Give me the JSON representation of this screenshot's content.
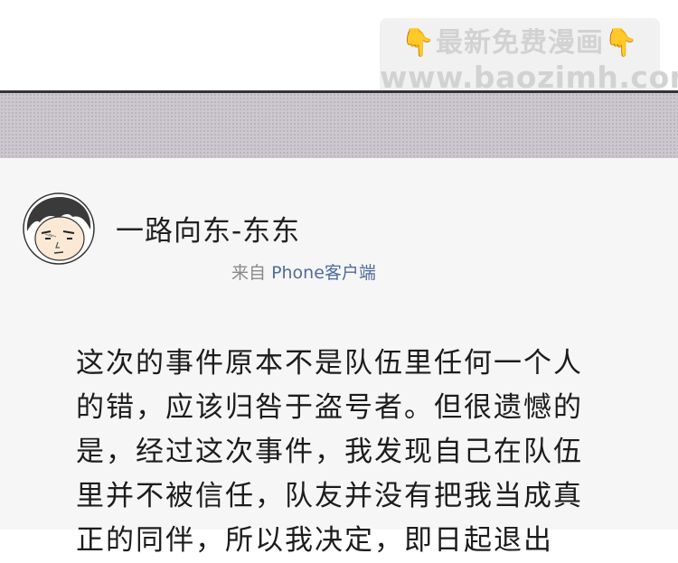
{
  "watermark": {
    "line1": "最新免费漫画",
    "line2": "www.baozimh.com"
  },
  "post": {
    "username": "一路向东-东东",
    "source_prefix": "来自",
    "source_client": "Phone客户端",
    "lines": [
      "这次的事件原本不是队伍里任何一个人",
      "的错，应该归咎于盗号者。但很遗憾的",
      "是，经过这次事件，我发现自己在队伍",
      "里并不被信任，队友并没有把我当成真",
      "正的同伴，所以我决定，即日起退出"
    ]
  },
  "colors": {
    "stripe_band": "#cdc8d0",
    "card_background": "#f6f6f6",
    "client_link": "#4e6d9a",
    "watermark_hand": "#f0b437"
  }
}
